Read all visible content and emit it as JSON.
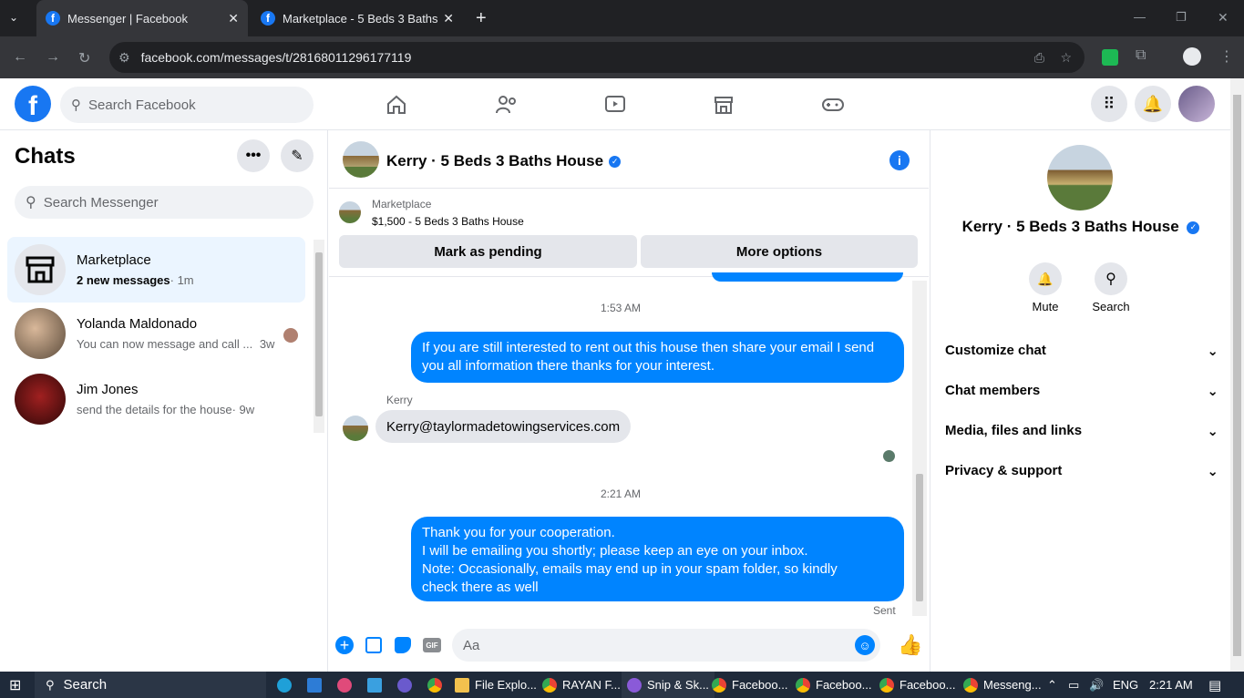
{
  "browser": {
    "tabs": [
      {
        "label": "Messenger | Facebook",
        "close": "✕"
      },
      {
        "label": "Marketplace - 5 Beds 3 Baths H",
        "close": "✕"
      }
    ],
    "new_tab": "+",
    "url": "facebook.com/messages/t/28168011296177119",
    "window_controls": [
      "—",
      "❐",
      "✕"
    ]
  },
  "fb": {
    "logo": "f",
    "search_placeholder": "Search Facebook"
  },
  "chats": {
    "title": "Chats",
    "search_placeholder": "Search Messenger",
    "items": [
      {
        "name": "Marketplace",
        "preview": "2 new messages",
        "time": "· 1m"
      },
      {
        "name": "Yolanda Maldonado",
        "preview": "You can now message and call ...",
        "time": "3w"
      },
      {
        "name": "Jim Jones",
        "preview": "send the details for the house",
        "time": "· 9w"
      }
    ]
  },
  "conversation": {
    "title": "Kerry · 5 Beds 3 Baths House",
    "marketplace_label": "Marketplace",
    "listing": "$1,500 - 5 Beds 3 Baths House",
    "mark_pending": "Mark as pending",
    "more_options": "More options",
    "time1": "1:53 AM",
    "msg1": "If you are still interested to rent out this house then share your email  I send you all information there thanks for your interest.",
    "sender": "Kerry",
    "msg2": "Kerry@taylormadetowingservices.com",
    "time2": "2:21 AM",
    "msg3_lines": [
      "Thank you for your cooperation.",
      "I will be emailing you shortly; please keep an eye on your inbox.",
      "Note: Occasionally, emails may end up in your spam folder, so kindly check there as well"
    ],
    "status": "Sent",
    "composer_placeholder": "Aa",
    "gif": "GIF"
  },
  "details": {
    "name": "Kerry · 5 Beds 3 Baths House",
    "mute": "Mute",
    "search": "Search",
    "sections": [
      "Customize chat",
      "Chat members",
      "Media, files and links",
      "Privacy & support"
    ]
  },
  "taskbar": {
    "search": "Search",
    "apps": [
      "File Explo...",
      "RAYAN F...",
      "Snip & Sk...",
      "Faceboo...",
      "Faceboo...",
      "Faceboo...",
      "Messeng..."
    ],
    "lang": "ENG",
    "clock": "2:21 AM"
  },
  "colors": {
    "fb_blue": "#1877f2",
    "bubble_blue": "#0084ff",
    "verified": "#1877f2"
  }
}
